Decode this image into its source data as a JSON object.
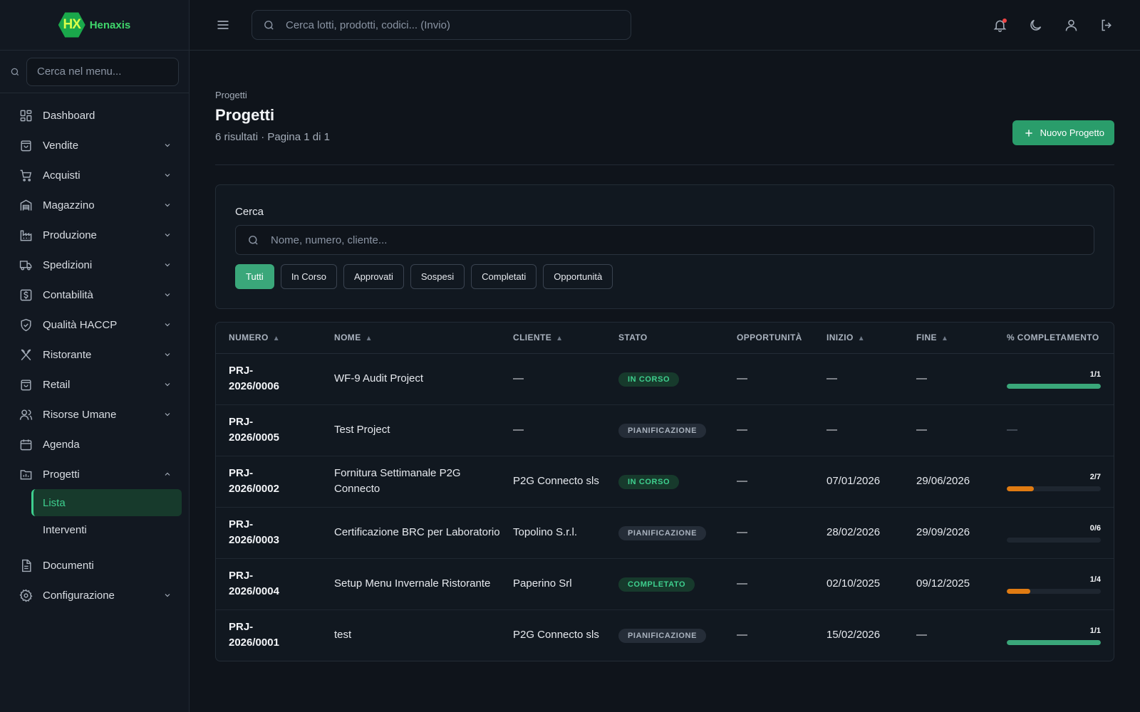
{
  "brand": {
    "logo_mark": "HX",
    "name": "Henaxis"
  },
  "sidebar": {
    "search_placeholder": "Cerca nel menu...",
    "items": [
      {
        "label": "Dashboard",
        "icon": "dashboard-icon",
        "has_chevron": false
      },
      {
        "label": "Vendite",
        "icon": "shopping-bag-icon",
        "has_chevron": true
      },
      {
        "label": "Acquisti",
        "icon": "cart-icon",
        "has_chevron": true
      },
      {
        "label": "Magazzino",
        "icon": "warehouse-icon",
        "has_chevron": true
      },
      {
        "label": "Produzione",
        "icon": "factory-icon",
        "has_chevron": true
      },
      {
        "label": "Spedizioni",
        "icon": "truck-icon",
        "has_chevron": true
      },
      {
        "label": "Contabilità",
        "icon": "dollar-icon",
        "has_chevron": true
      },
      {
        "label": "Qualità HACCP",
        "icon": "shield-icon",
        "has_chevron": true
      },
      {
        "label": "Ristorante",
        "icon": "utensils-icon",
        "has_chevron": true
      },
      {
        "label": "Retail",
        "icon": "store-icon",
        "has_chevron": true
      },
      {
        "label": "Risorse Umane",
        "icon": "users-icon",
        "has_chevron": true
      },
      {
        "label": "Agenda",
        "icon": "calendar-icon",
        "has_chevron": false
      },
      {
        "label": "Progetti",
        "icon": "folder-chart-icon",
        "has_chevron": true,
        "expanded": true
      }
    ],
    "sub_items": [
      {
        "label": "Lista",
        "active": true
      },
      {
        "label": "Interventi",
        "active": false
      }
    ],
    "bottom_items": [
      {
        "label": "Documenti",
        "icon": "document-icon",
        "has_chevron": false
      },
      {
        "label": "Configurazione",
        "icon": "gear-icon",
        "has_chevron": true
      }
    ]
  },
  "header": {
    "search_placeholder": "Cerca lotti, prodotti, codici... (Invio)"
  },
  "page": {
    "breadcrumb": "Progetti",
    "title": "Progetti",
    "subtitle": "6 risultati · Pagina 1 di 1",
    "new_button": "Nuovo Progetto"
  },
  "filters": {
    "label": "Cerca",
    "placeholder": "Nome, numero, cliente...",
    "chips": [
      {
        "label": "Tutti",
        "active": true
      },
      {
        "label": "In Corso",
        "active": false
      },
      {
        "label": "Approvati",
        "active": false
      },
      {
        "label": "Sospesi",
        "active": false
      },
      {
        "label": "Completati",
        "active": false
      },
      {
        "label": "Opportunità",
        "active": false
      }
    ]
  },
  "table": {
    "columns": [
      {
        "label": "NUMERO",
        "sortable": true
      },
      {
        "label": "NOME",
        "sortable": true
      },
      {
        "label": "CLIENTE",
        "sortable": true
      },
      {
        "label": "STATO",
        "sortable": false
      },
      {
        "label": "OPPORTUNITÀ",
        "sortable": false
      },
      {
        "label": "INIZIO",
        "sortable": true
      },
      {
        "label": "FINE",
        "sortable": true
      },
      {
        "label": "% COMPLETAMENTO",
        "sortable": false
      }
    ],
    "rows": [
      {
        "numero": "PRJ-\n2026/0006",
        "nome": "WF-9 Audit Project",
        "cliente": "—",
        "stato": "IN CORSO",
        "stato_kind": "inc",
        "opportunita": "—",
        "inizio": "—",
        "fine": "—",
        "progress_label": "1/1",
        "progress": 1.0,
        "progress_color": "#3aa77a"
      },
      {
        "numero": "PRJ-\n2026/0005",
        "nome": "Test Project",
        "cliente": "—",
        "stato": "PIANIFICAZIONE",
        "stato_kind": "pia",
        "opportunita": "—",
        "inizio": "—",
        "fine": "—",
        "progress_label": "—",
        "progress": null,
        "progress_color": ""
      },
      {
        "numero": "PRJ-\n2026/0002",
        "nome": "Fornitura Settimanale P2G Connecto",
        "cliente": "P2G Connecto sls",
        "stato": "IN CORSO",
        "stato_kind": "inc",
        "opportunita": "—",
        "inizio": "07/01/2026",
        "fine": "29/06/2026",
        "progress_label": "2/7",
        "progress": 0.2857,
        "progress_color": "#e07b12"
      },
      {
        "numero": "PRJ-\n2026/0003",
        "nome": "Certificazione BRC per Laboratorio",
        "cliente": "Topolino S.r.l.",
        "stato": "PIANIFICAZIONE",
        "stato_kind": "pia",
        "opportunita": "—",
        "inizio": "28/02/2026",
        "fine": "29/09/2026",
        "progress_label": "0/6",
        "progress": 0.0,
        "progress_color": "#e07b12"
      },
      {
        "numero": "PRJ-\n2026/0004",
        "nome": "Setup Menu Invernale Ristorante",
        "cliente": "Paperino Srl",
        "stato": "COMPLETATO",
        "stato_kind": "com",
        "opportunita": "—",
        "inizio": "02/10/2025",
        "fine": "09/12/2025",
        "progress_label": "1/4",
        "progress": 0.25,
        "progress_color": "#e07b12"
      },
      {
        "numero": "PRJ-\n2026/0001",
        "nome": "test",
        "cliente": "P2G Connecto sls",
        "stato": "PIANIFICAZIONE",
        "stato_kind": "pia",
        "opportunita": "—",
        "inizio": "15/02/2026",
        "fine": "—",
        "progress_label": "1/1",
        "progress": 1.0,
        "progress_color": "#3aa77a"
      }
    ]
  }
}
